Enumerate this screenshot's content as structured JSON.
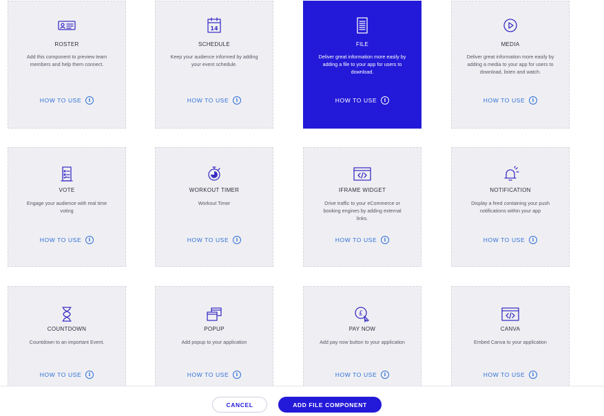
{
  "components": [
    {
      "id": "roster",
      "icon": "id-card-icon",
      "title": "ROSTER",
      "description": "Add this component to preview team members and help them connect.",
      "how_to": "HOW TO USE",
      "selected": false
    },
    {
      "id": "schedule",
      "icon": "calendar-icon",
      "icon_text": "14",
      "title": "SCHEDULE",
      "description": "Keep your audience informed by adding your event schedule.",
      "how_to": "HOW TO USE",
      "selected": false
    },
    {
      "id": "file",
      "icon": "file-icon",
      "title": "FILE",
      "description": "Deliver great information more easily by adding a file to your app for users to download.",
      "how_to": "HOW TO USE",
      "selected": true
    },
    {
      "id": "media",
      "icon": "play-icon",
      "title": "MEDIA",
      "description": "Deliver great information more easily by adding a media to your app for users to download, listen and watch.",
      "how_to": "HOW TO USE",
      "selected": false
    },
    {
      "id": "vote",
      "icon": "ballot-icon",
      "title": "VOTE",
      "description": "Engage your audience with real time voting",
      "how_to": "HOW TO USE",
      "selected": false
    },
    {
      "id": "workout_timer",
      "icon": "stopwatch-icon",
      "title": "WORKOUT TIMER",
      "description": "Workout Timer",
      "how_to": "HOW TO USE",
      "selected": false
    },
    {
      "id": "iframe_widget",
      "icon": "code-window-icon",
      "title": "IFRAME WIDGET",
      "description": "Drive traffic to your eCommerce or booking engines by adding external links.",
      "how_to": "HOW TO USE",
      "selected": false
    },
    {
      "id": "notification",
      "icon": "bell-icon",
      "title": "NOTIFICATION",
      "description": "Display a feed containing your push notifications within your app",
      "how_to": "HOW TO USE",
      "selected": false
    },
    {
      "id": "countdown",
      "icon": "hourglass-icon",
      "title": "COUNTDOWN",
      "description": "Countdown to an important Event.",
      "how_to": "HOW TO USE",
      "selected": false
    },
    {
      "id": "popup",
      "icon": "popup-windows-icon",
      "title": "POPUP",
      "description": "Add popup to your application",
      "how_to": "HOW TO USE",
      "selected": false
    },
    {
      "id": "pay_now",
      "icon": "pay-pointer-icon",
      "icon_text": "£",
      "title": "PAY NOW",
      "description": "Add pay now button to your application",
      "how_to": "HOW TO USE",
      "selected": false
    },
    {
      "id": "canva",
      "icon": "code-window-icon",
      "title": "CANVA",
      "description": "Embed Canva to your application",
      "how_to": "HOW TO USE",
      "selected": false
    }
  ],
  "info_glyph": "i",
  "footer": {
    "cancel_label": "CANCEL",
    "add_label": "ADD FILE COMPONENT"
  },
  "colors": {
    "accent": "#2319d8",
    "card_bg": "#efeff3",
    "link": "#2f6fd6",
    "icon_stroke": "#3a2fc4"
  }
}
